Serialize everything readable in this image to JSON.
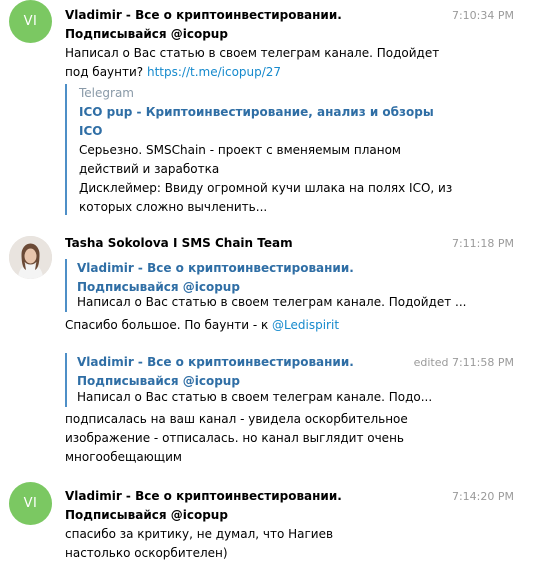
{
  "messages": [
    {
      "avatar_initials": "VI",
      "sender": "Vladimir - Все о криптоинвестировании. Подписывайся @icopup",
      "time": "7:10:34 PM",
      "text_before_link": "Написал о Вас статью в своем телеграм канале. Подойдет под баунти? ",
      "link": "https://t.me/icopup/27",
      "preview": {
        "site": "Telegram",
        "title": "ICO pup - Криптоинвестирование, анализ и обзоры ICO",
        "description": "Серьезно. SMSChain - проект с вменяемым планом действий и заработка\nДисклеймер: Ввиду огромной кучи шлака на полях ICO, из которых сложно вычленить..."
      }
    },
    {
      "sender": "Tasha Sokolova I SMS Chain Team",
      "time": "7:11:18 PM",
      "reply": {
        "author": "Vladimir - Все о криптоинвестировании. Подписывайся @icopup",
        "text": "Написал о Вас статью в своем телеграм канале. Подойдет ..."
      },
      "text": "Спасибо большое. По баунти - к ",
      "mention": "@Ledispirit"
    },
    {
      "time": "edited 7:11:58 PM",
      "reply": {
        "author": "Vladimir - Все о криптоинвестировании. Подписывайся @icopup",
        "text": "Написал о Вас статью в своем телеграм канале. Подо..."
      },
      "text": "подписалась на ваш канал - увидела оскорбительное изображение - отписалась. но канал выглядит очень многообещающим"
    },
    {
      "avatar_initials": "VI",
      "sender": "Vladimir - Все о криптоинвестировании. Подписывайся @icopup",
      "time": "7:14:20 PM",
      "text": "спасибо за критику, не думал, что Нагиев настолько оскорбителен)"
    }
  ]
}
